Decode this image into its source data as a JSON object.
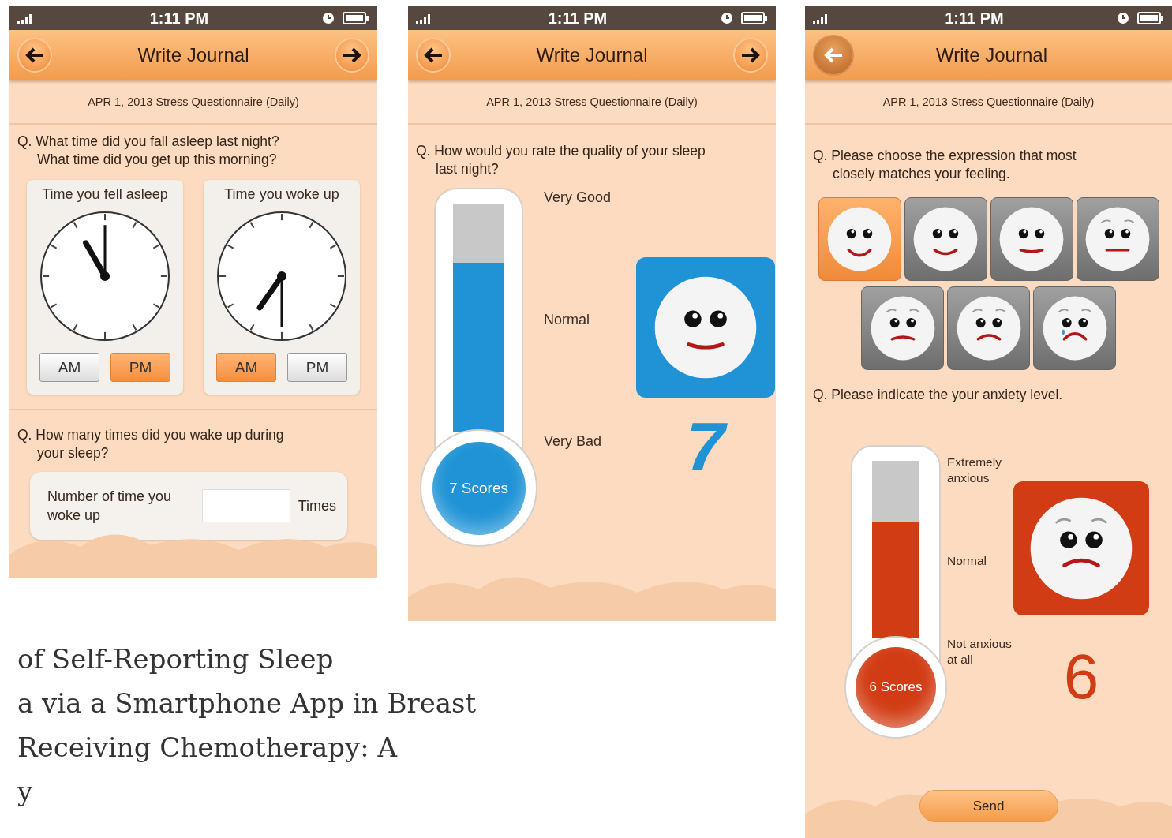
{
  "screens": [
    {
      "time": "1:11 PM",
      "title": "Write Journal",
      "forward": true,
      "subtitle": "APR 1, 2013 Stress Questionnaire (Daily)",
      "sections": [
        {
          "kind": "clocks",
          "question": [
            "Q. What time did you fall asleep last night?",
            "What time did you get up this morning?"
          ],
          "clocks": [
            {
              "label": "Time you fell asleep",
              "toggles": [
                {
                  "label": "AM",
                  "selected": false
                },
                {
                  "label": "PM",
                  "selected": true
                }
              ]
            },
            {
              "label": "Time you woke up",
              "toggles": [
                {
                  "label": "AM",
                  "selected": true
                },
                {
                  "label": "PM",
                  "selected": false
                }
              ]
            }
          ]
        },
        {
          "kind": "count",
          "question": [
            "Q. How many times did you wake up during",
            "your sleep?"
          ],
          "field_label": "Number of time you woke up",
          "unit": "Times"
        }
      ]
    },
    {
      "time": "1:11 PM",
      "title": "Write Journal",
      "forward": true,
      "subtitle": "APR 1, 2013 Stress Questionnaire (Daily)",
      "sections": [
        {
          "kind": "thermometer",
          "question": [
            "Q. How would you rate the quality of your sleep",
            "last night?"
          ],
          "color": "#1f93d6",
          "scale": [
            "Very Good",
            "Normal",
            "Very Bad"
          ],
          "level": 0.74,
          "bulb_label": "7 Scores",
          "score": "7"
        }
      ]
    },
    {
      "time": "1:11 PM",
      "title": "Write Journal",
      "forward": false,
      "subtitle": "APR 1, 2013 Stress Questionnaire (Daily)",
      "sections": [
        {
          "kind": "faces",
          "question": [
            "Q. Please choose the expression that most",
            "closely matches your feeling."
          ],
          "faces": [
            {
              "selected": true
            },
            {
              "selected": false
            },
            {
              "selected": false
            },
            {
              "selected": false
            },
            {
              "selected": false
            },
            {
              "selected": false
            },
            {
              "selected": false
            }
          ]
        },
        {
          "kind": "thermometer",
          "question": [
            "Q. Please indicate the your anxiety level."
          ],
          "color": "#d23c14",
          "scale": [
            "Extremely anxious",
            "Normal",
            "Not anxious at all"
          ],
          "level": 0.66,
          "bulb_label": "6 Scores",
          "score": "6"
        },
        {
          "kind": "send",
          "label": "Send"
        }
      ]
    }
  ],
  "article_title_lines": [
    "of Self-Reporting Sleep",
    "a via a Smartphone App in Breast",
    "Receiving Chemotherapy: A",
    "y"
  ]
}
